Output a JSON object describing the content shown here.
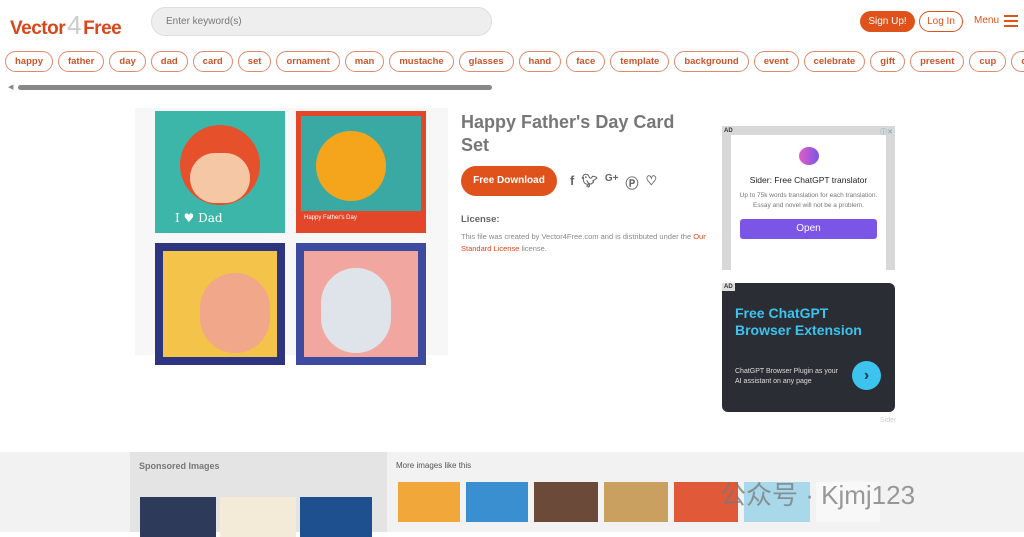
{
  "header": {
    "logo_left": "Vector",
    "logo_mid": "4",
    "logo_right": "Free",
    "search_placeholder": "Enter keyword(s)",
    "signup": "Sign Up!",
    "login": "Log In",
    "menu": "Menu"
  },
  "tags": [
    "happy",
    "father",
    "day",
    "dad",
    "card",
    "set",
    "ornament",
    "man",
    "mustache",
    "glasses",
    "hand",
    "face",
    "template",
    "background",
    "event",
    "celebrate",
    "gift",
    "present",
    "cup",
    "coffee"
  ],
  "main": {
    "title": "Happy Father's Day Card Set",
    "download": "Free Download",
    "share_icons": [
      "facebook-icon",
      "twitter-icon",
      "google-plus-icon",
      "pinterest-icon",
      "heart-icon"
    ],
    "license_label": "License:",
    "license_text_1": "This file was created by Vector4Free.com and is distributed under the ",
    "license_link": "Our Standard License",
    "license_text_2": " license.",
    "card1_text": "I ♥ Dad",
    "card2_text": "Happy Father's Day"
  },
  "ads": {
    "ad_label": "AD",
    "ad1_title": "Sider: Free ChatGPT translator",
    "ad1_desc": "Up to 75k words translation for each translation. Essay and novel will not be a problem.",
    "ad1_button": "Open",
    "ad2_title": "Free ChatGPT Browser Extension",
    "ad2_desc": "ChatGPT Browser Plugin as your AI assistant on any page",
    "ad2_brand": "Sider"
  },
  "bottom": {
    "sponsored": "Sponsored Images",
    "more": "More images like this"
  },
  "watermark": "公众号 · Kjmj123",
  "colors": {
    "brand": "#e0521b",
    "ad_button": "#7b55e6",
    "ad_accent": "#3cc3ee"
  }
}
